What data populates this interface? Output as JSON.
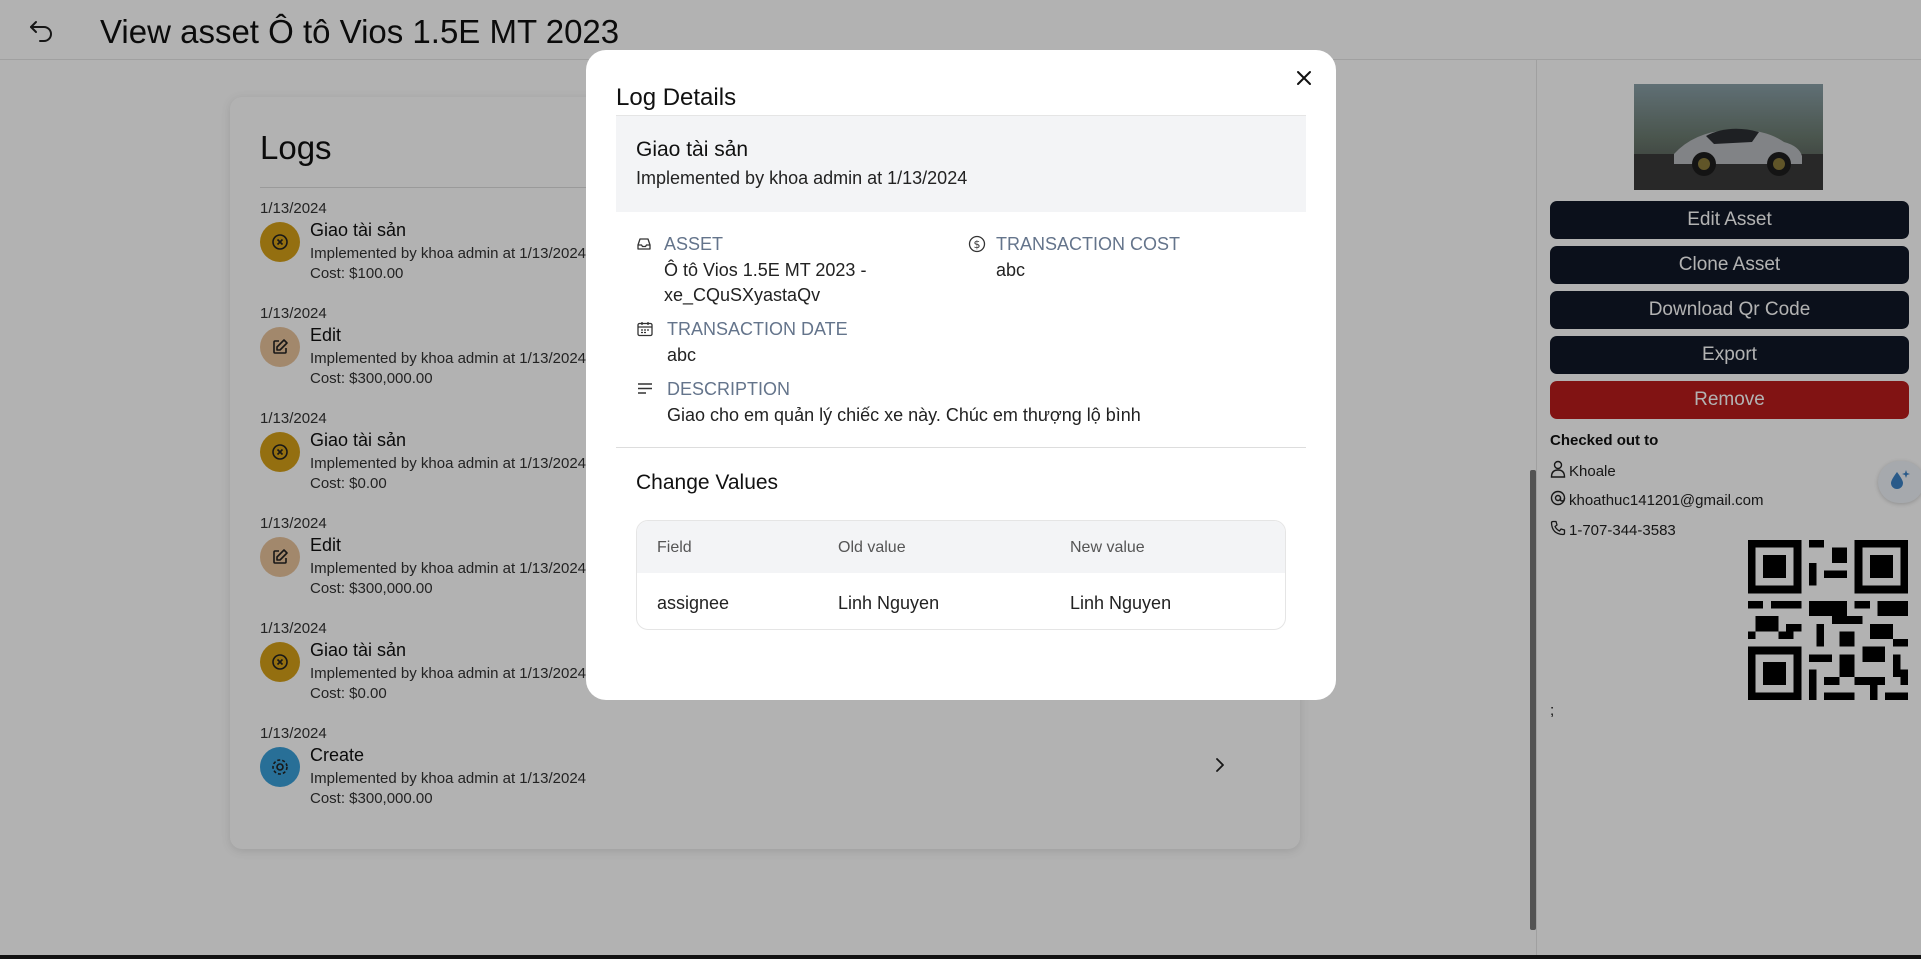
{
  "header": {
    "title": "View asset Ô tô Vios 1.5E MT 2023"
  },
  "logs": {
    "title": "Logs",
    "items": [
      {
        "date": "1/13/2024",
        "title": "Giao tài sản",
        "implemented": "Implemented by khoa admin at 1/13/2024",
        "cost": "Cost: $100.00",
        "icon": "x-circle-icon",
        "icon_color": "#d4a017"
      },
      {
        "date": "1/13/2024",
        "title": "Edit",
        "implemented": "Implemented by khoa admin at 1/13/2024",
        "cost": "Cost: $300,000.00",
        "icon": "edit-icon",
        "icon_color": "#e9c39b"
      },
      {
        "date": "1/13/2024",
        "title": "Giao tài sản",
        "implemented": "Implemented by khoa admin at 1/13/2024",
        "cost": "Cost: $0.00",
        "icon": "x-circle-icon",
        "icon_color": "#d4a017"
      },
      {
        "date": "1/13/2024",
        "title": "Edit",
        "implemented": "Implemented by khoa admin at 1/13/2024",
        "cost": "Cost: $300,000.00",
        "icon": "edit-icon",
        "icon_color": "#e9c39b"
      },
      {
        "date": "1/13/2024",
        "title": "Giao tài sản",
        "implemented": "Implemented by khoa admin at 1/13/2024",
        "cost": "Cost: $0.00",
        "icon": "x-circle-icon",
        "icon_color": "#d4a017"
      },
      {
        "date": "1/13/2024",
        "title": "Create",
        "implemented": "Implemented by khoa admin at 1/13/2024",
        "cost": "Cost: $300,000.00",
        "icon": "gear-icon",
        "icon_color": "#3aa0d8"
      }
    ]
  },
  "sidebar": {
    "buttons": {
      "edit": "Edit Asset",
      "clone": "Clone Asset",
      "download_qr": "Download Qr Code",
      "export": "Export",
      "remove": "Remove"
    },
    "checked_out_label": "Checked out to",
    "user_name": "Khoale",
    "email": "khoathuc141201@gmail.com",
    "phone": "1-707-344-3583",
    "note": ";"
  },
  "modal": {
    "title": "Log Details",
    "summary_title": "Giao tài sản",
    "summary_sub": "Implemented by khoa admin at 1/13/2024",
    "asset_label": "ASSET",
    "asset_value": "Ô tô Vios 1.5E MT 2023 - xe_CQuSXyastaQv",
    "cost_label": "TRANSACTION COST",
    "cost_value": "abc",
    "date_label": "TRANSACTION DATE",
    "date_value": "abc",
    "desc_label": "DESCRIPTION",
    "desc_value": "Giao cho em quản lý chiếc xe này. Chúc em thượng lộ bình",
    "change_title": "Change Values",
    "table": {
      "headers": [
        "Field",
        "Old value",
        "New value"
      ],
      "rows": [
        [
          "assignee",
          "Linh Nguyen",
          "Linh Nguyen"
        ]
      ]
    }
  },
  "colors": {
    "button_dark": "#111827",
    "button_remove": "#b91c1c",
    "label_muted": "#64748b"
  }
}
